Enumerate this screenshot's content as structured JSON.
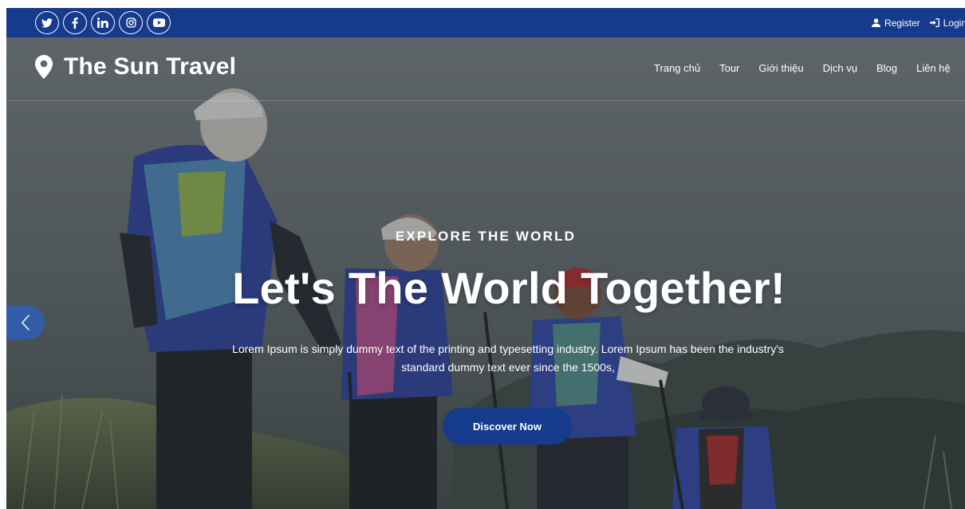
{
  "topbar": {
    "socials": [
      {
        "icon": "twitter-icon"
      },
      {
        "icon": "facebook-icon"
      },
      {
        "icon": "linkedin-icon"
      },
      {
        "icon": "instagram-icon"
      },
      {
        "icon": "youtube-icon"
      }
    ],
    "register_label": "Register",
    "login_label": "Login"
  },
  "brand": {
    "name": "The Sun Travel",
    "icon": "location-pin-icon"
  },
  "nav": {
    "items": [
      {
        "label": "Trang chủ"
      },
      {
        "label": "Tour"
      },
      {
        "label": "Giới thiệu"
      },
      {
        "label": "Dịch vụ"
      },
      {
        "label": "Blog"
      },
      {
        "label": "Liên hệ"
      }
    ]
  },
  "hero": {
    "eyebrow": "EXPLORE THE WORLD",
    "title": "Let's The World Together!",
    "description": "Lorem Ipsum is simply dummy text of the printing and typesetting industry. Lorem Ipsum has been the industry's standard dummy text ever since the 1500s,",
    "cta_label": "Discover Now"
  },
  "colors": {
    "primary": "#163a8c",
    "arrow": "#2f5fb0",
    "text": "#ffffff"
  }
}
